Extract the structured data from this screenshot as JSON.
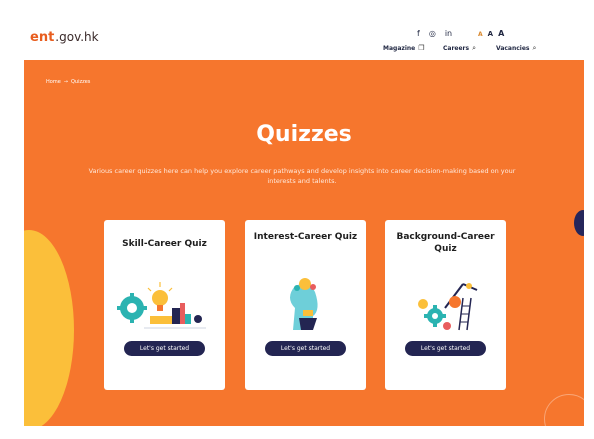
{
  "header": {
    "logo_bold": "ent",
    "logo_light": ".gov.hk",
    "social": [
      "f",
      "◎",
      "in"
    ],
    "font_sizes": [
      "A",
      "A",
      "A"
    ],
    "nav": [
      {
        "label": "Magazine",
        "icon": "book-icon"
      },
      {
        "label": "Careers",
        "icon": "search-icon"
      },
      {
        "label": "Vacancies",
        "icon": "search-icon"
      }
    ]
  },
  "breadcrumb": {
    "home": "Home",
    "separator": "→",
    "current": "Quizzes"
  },
  "page": {
    "title": "Quizzes",
    "description": "Various career quizzes here can help you explore career pathways and develop insights into career decision-making based on your interests and talents."
  },
  "cards": [
    {
      "title": "Skill-Career Quiz",
      "button": "Let's get started"
    },
    {
      "title": "Interest-Career Quiz",
      "button": "Let's get started"
    },
    {
      "title": "Background-Career Quiz",
      "button": "Let's get started"
    }
  ],
  "colors": {
    "accent": "#f6762d",
    "navy": "#232552",
    "yellow": "#fbbf3a"
  }
}
